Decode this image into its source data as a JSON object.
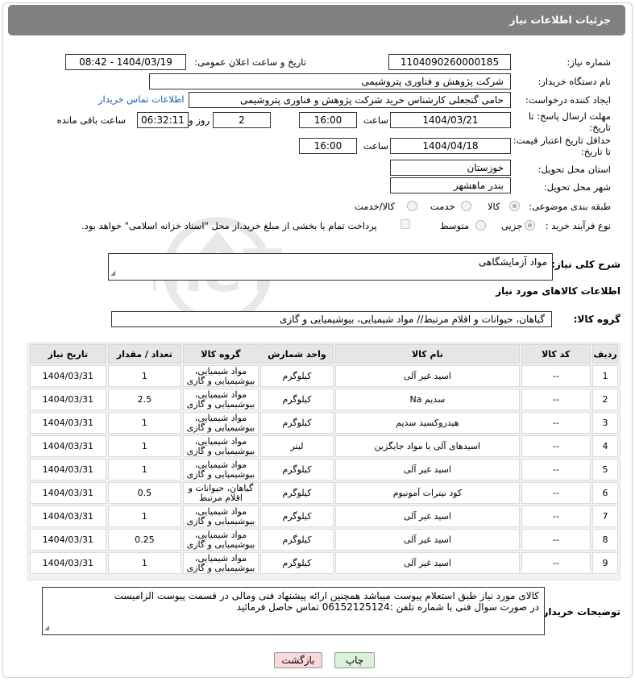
{
  "header": {
    "title": "جزئیات اطلاعات نیاز"
  },
  "form": {
    "need_number_label": "شماره نیاز:",
    "need_number": "1104090260000185",
    "announce_label": "تاریخ و ساعت اعلان عمومی:",
    "announce_value": "1404/03/19 - 08:42",
    "buyer_org_label": "نام دستگاه خریدار:",
    "buyer_org": "شرکت پژوهش و فناوری پتروشیمی",
    "requester_label": "ایجاد کننده درخواست:",
    "requester": "حامی گنجعلی کارشناس خرید شرکت پژوهش و فناوری پتروشیمی",
    "buyer_contact_link": "اطلاعات تماس خریدار",
    "reply_deadline_label_1": "مهلت ارسال پاسخ: تا",
    "reply_deadline_label_2": "تاریخ:",
    "reply_date": "1404/03/21",
    "time_label": "ساعت",
    "reply_time": "16:00",
    "days_value": "2",
    "days_label": "روز و",
    "remaining_time": "06:32:11",
    "remaining_label": "ساعت باقی مانده",
    "price_deadline_label_1": "حداقل تاریخ اعتبار قیمت:",
    "price_deadline_label_2": "تا تاریخ:",
    "price_date": "1404/04/18",
    "price_time_label": "ساعت",
    "price_time": "16:00",
    "province_label": "استان محل تحویل:",
    "province": "خوزستان",
    "city_label": "شهر محل تحویل:",
    "city": "بندر ماهشهر",
    "category_label": "طبقه بندی موضوعی:",
    "category_options": [
      "کالا",
      "خدمت",
      "کالا/خدمت"
    ],
    "category_selected": "کالا",
    "process_label": "نوع فرآیند خرید :",
    "process_options": [
      "جزیی",
      "متوسط"
    ],
    "process_selected": "جزیی",
    "payment_note": "پرداخت تمام یا بخشی از مبلغ خرید،از محل \"اسناد خزانه اسلامی\" خواهد بود.",
    "description_label": "شرح کلی نیاز:",
    "description": "مواد آزمایشگاهی",
    "goods_info_title": "اطلاعات کالاهای مورد نیاز",
    "goods_group_label": "گروه کالا:",
    "goods_group": "گیاهان، حیوانات و اقلام مرتبط// مواد شیمیایی، بیوشیمیایی و  گازی",
    "buyer_notes_label": "توضیحات خریدار:",
    "buyer_notes_1": "کالای مورد نیاز طبق استعلام پیوست میباشد همچنین ارائه پیشنهاد فنی ومالی در قسمت پیوست الزامیست",
    "buyer_notes_2": "در صورت سوال فنی با شماره تلفن :06152125124 تماس حاصل فرمائید"
  },
  "table": {
    "headers": [
      "ردیف",
      "کد کالا",
      "نام کالا",
      "واحد شمارش",
      "گروه کالا",
      "تعداد / مقدار",
      "تاریخ نیاز"
    ],
    "rows": [
      [
        "1",
        "--",
        "اسید غیر آلی",
        "کیلوگرم",
        "مواد شیمیایی، بیوشیمیایی و گازی",
        "1",
        "1404/03/31"
      ],
      [
        "2",
        "--",
        "سدیم Na",
        "کیلوگرم",
        "مواد شیمیایی، بیوشیمیایی و گازی",
        "2.5",
        "1404/03/31"
      ],
      [
        "3",
        "--",
        "هیدروکسید سدیم",
        "کیلوگرم",
        "مواد شیمیایی، بیوشیمیایی و گازی",
        "1",
        "1404/03/31"
      ],
      [
        "4",
        "--",
        "اسیدهای آلی یا مواد جایگزین",
        "لیتر",
        "مواد شیمیایی، بیوشیمیایی و گازی",
        "1",
        "1404/03/31"
      ],
      [
        "5",
        "--",
        "اسید غیر آلی",
        "کیلوگرم",
        "مواد شیمیایی، بیوشیمیایی و گازی",
        "1",
        "1404/03/31"
      ],
      [
        "6",
        "--",
        "کود نیترات آمونیوم",
        "کیلوگرم",
        "گیاهان، حیوانات و اقلام مرتبط",
        "0.5",
        "1404/03/31"
      ],
      [
        "7",
        "--",
        "اسید غیر آلی",
        "کیلوگرم",
        "مواد شیمیایی، بیوشیمیایی و گازی",
        "1",
        "1404/03/31"
      ],
      [
        "8",
        "--",
        "اسید غیر آلی",
        "کیلوگرم",
        "مواد شیمیایی، بیوشیمیایی و گازی",
        "0.25",
        "1404/03/31"
      ],
      [
        "9",
        "--",
        "اسید غیر آلی",
        "کیلوگرم",
        "مواد شیمیایی، بیوشیمیایی و گازی",
        "1",
        "1404/03/31"
      ]
    ]
  },
  "buttons": {
    "print": "چاپ",
    "back": "بازگشت"
  },
  "watermark": {
    "text": "AriaTender.neT"
  },
  "colors": {
    "title_bar": "#808080",
    "link": "#1a5fb4",
    "print_btn": "#d9f2d9",
    "back_btn": "#f8d8d8"
  }
}
